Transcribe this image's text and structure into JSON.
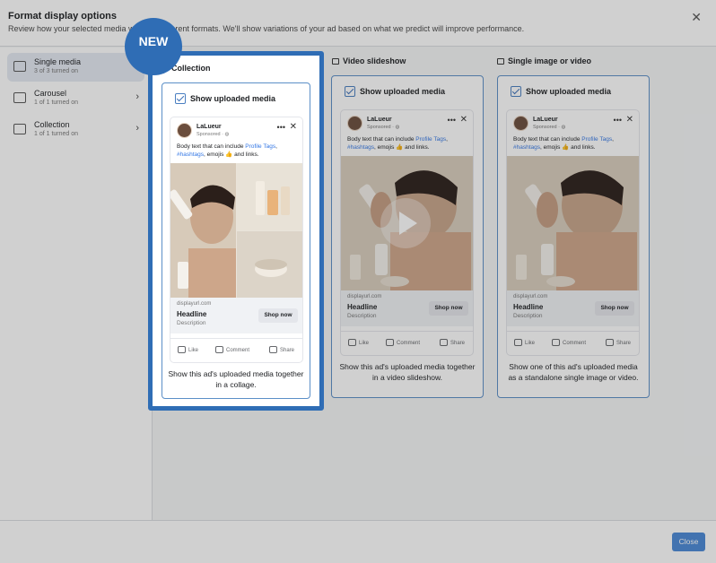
{
  "header": {
    "title": "Format display options",
    "subtitle": "Review how your selected media w... ross different formats. We'll show variations of your ad based on what we predict will improve performance.",
    "close_icon": "close-icon"
  },
  "badge": {
    "label": "NEW"
  },
  "sidebar": {
    "items": [
      {
        "label": "Single media",
        "sub": "3 of 3 turned on",
        "icon": "image-icon",
        "active": true
      },
      {
        "label": "Carousel",
        "sub": "1 of 1 turned on",
        "icon": "carousel-icon",
        "active": false
      },
      {
        "label": "Collection",
        "sub": "1 of 1 turned on",
        "icon": "collection-icon",
        "active": false
      }
    ]
  },
  "columns": [
    {
      "title": "Collection",
      "checkbox_label": "Show uploaded media",
      "caption": "Show this ad's uploaded media together in a collage."
    },
    {
      "title": "Video slideshow",
      "checkbox_label": "Show uploaded media",
      "caption": "Show this ad's uploaded media together in a video slideshow."
    },
    {
      "title": "Single image or video",
      "checkbox_label": "Show uploaded media",
      "caption": "Show one of this ad's uploaded media as a standalone single image or video."
    }
  ],
  "ad": {
    "brand": "LaLueur",
    "sponsored": "Sponsored · ",
    "body_prefix": "Body text that can include ",
    "body_link1": "Profile Tags",
    "body_mid": ", ",
    "body_link2": "#hashtags",
    "body_suffix": ", emojis 👍 and links.",
    "url": "displayurl.com",
    "headline": "Headline",
    "description": "Description",
    "cta": "Shop now",
    "like": "Like",
    "comment": "Comment",
    "share": "Share"
  },
  "footer": {
    "close_label": "Close"
  },
  "colors": {
    "accent": "#2f6db5",
    "card_border": "#5b8fc7",
    "link": "#3578e5"
  }
}
